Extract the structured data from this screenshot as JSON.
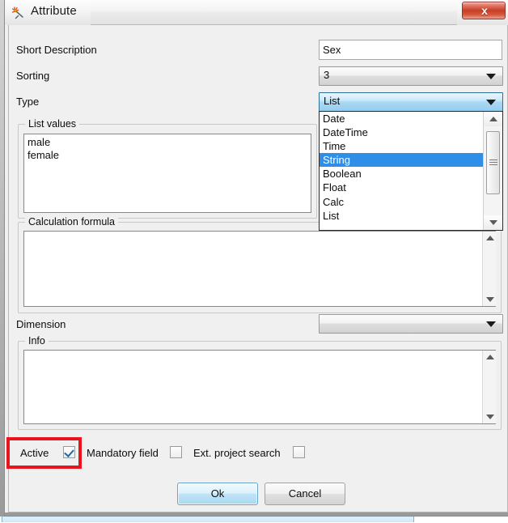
{
  "background": {
    "description": "blurred parent window strip"
  },
  "window": {
    "title": "Attribute",
    "icon": "attribute-icon",
    "close_label": "x"
  },
  "form": {
    "short_description": {
      "label": "Short Description",
      "value": "Sex",
      "placeholder": ""
    },
    "sorting": {
      "label": "Sorting",
      "value": "3"
    },
    "type": {
      "label": "Type",
      "value": "List",
      "options": [
        "Date",
        "DateTime",
        "Time",
        "String",
        "Boolean",
        "Float",
        "Calc",
        "List"
      ],
      "highlighted_option": "String"
    },
    "dimension": {
      "label": "Dimension",
      "value": ""
    }
  },
  "list_values": {
    "title": "List values",
    "value": "male\nfemale"
  },
  "calculation_formula": {
    "title": "Calculation formula",
    "value": ""
  },
  "info": {
    "title": "Info",
    "value": ""
  },
  "checkboxes": [
    {
      "label": "Active",
      "checked": true
    },
    {
      "label": "Mandatory field",
      "checked": false
    },
    {
      "label": "Ext. project search",
      "checked": false
    }
  ],
  "buttons": {
    "ok": "Ok",
    "cancel": "Cancel"
  },
  "colors": {
    "highlight_blue": "#2f8fe8",
    "annotation_red": "#e8161c",
    "close_red": "#c63f27",
    "dialog_bg": "#f0f0f0"
  },
  "annotation": {
    "target": "Active checkbox",
    "shape": "rectangle"
  }
}
